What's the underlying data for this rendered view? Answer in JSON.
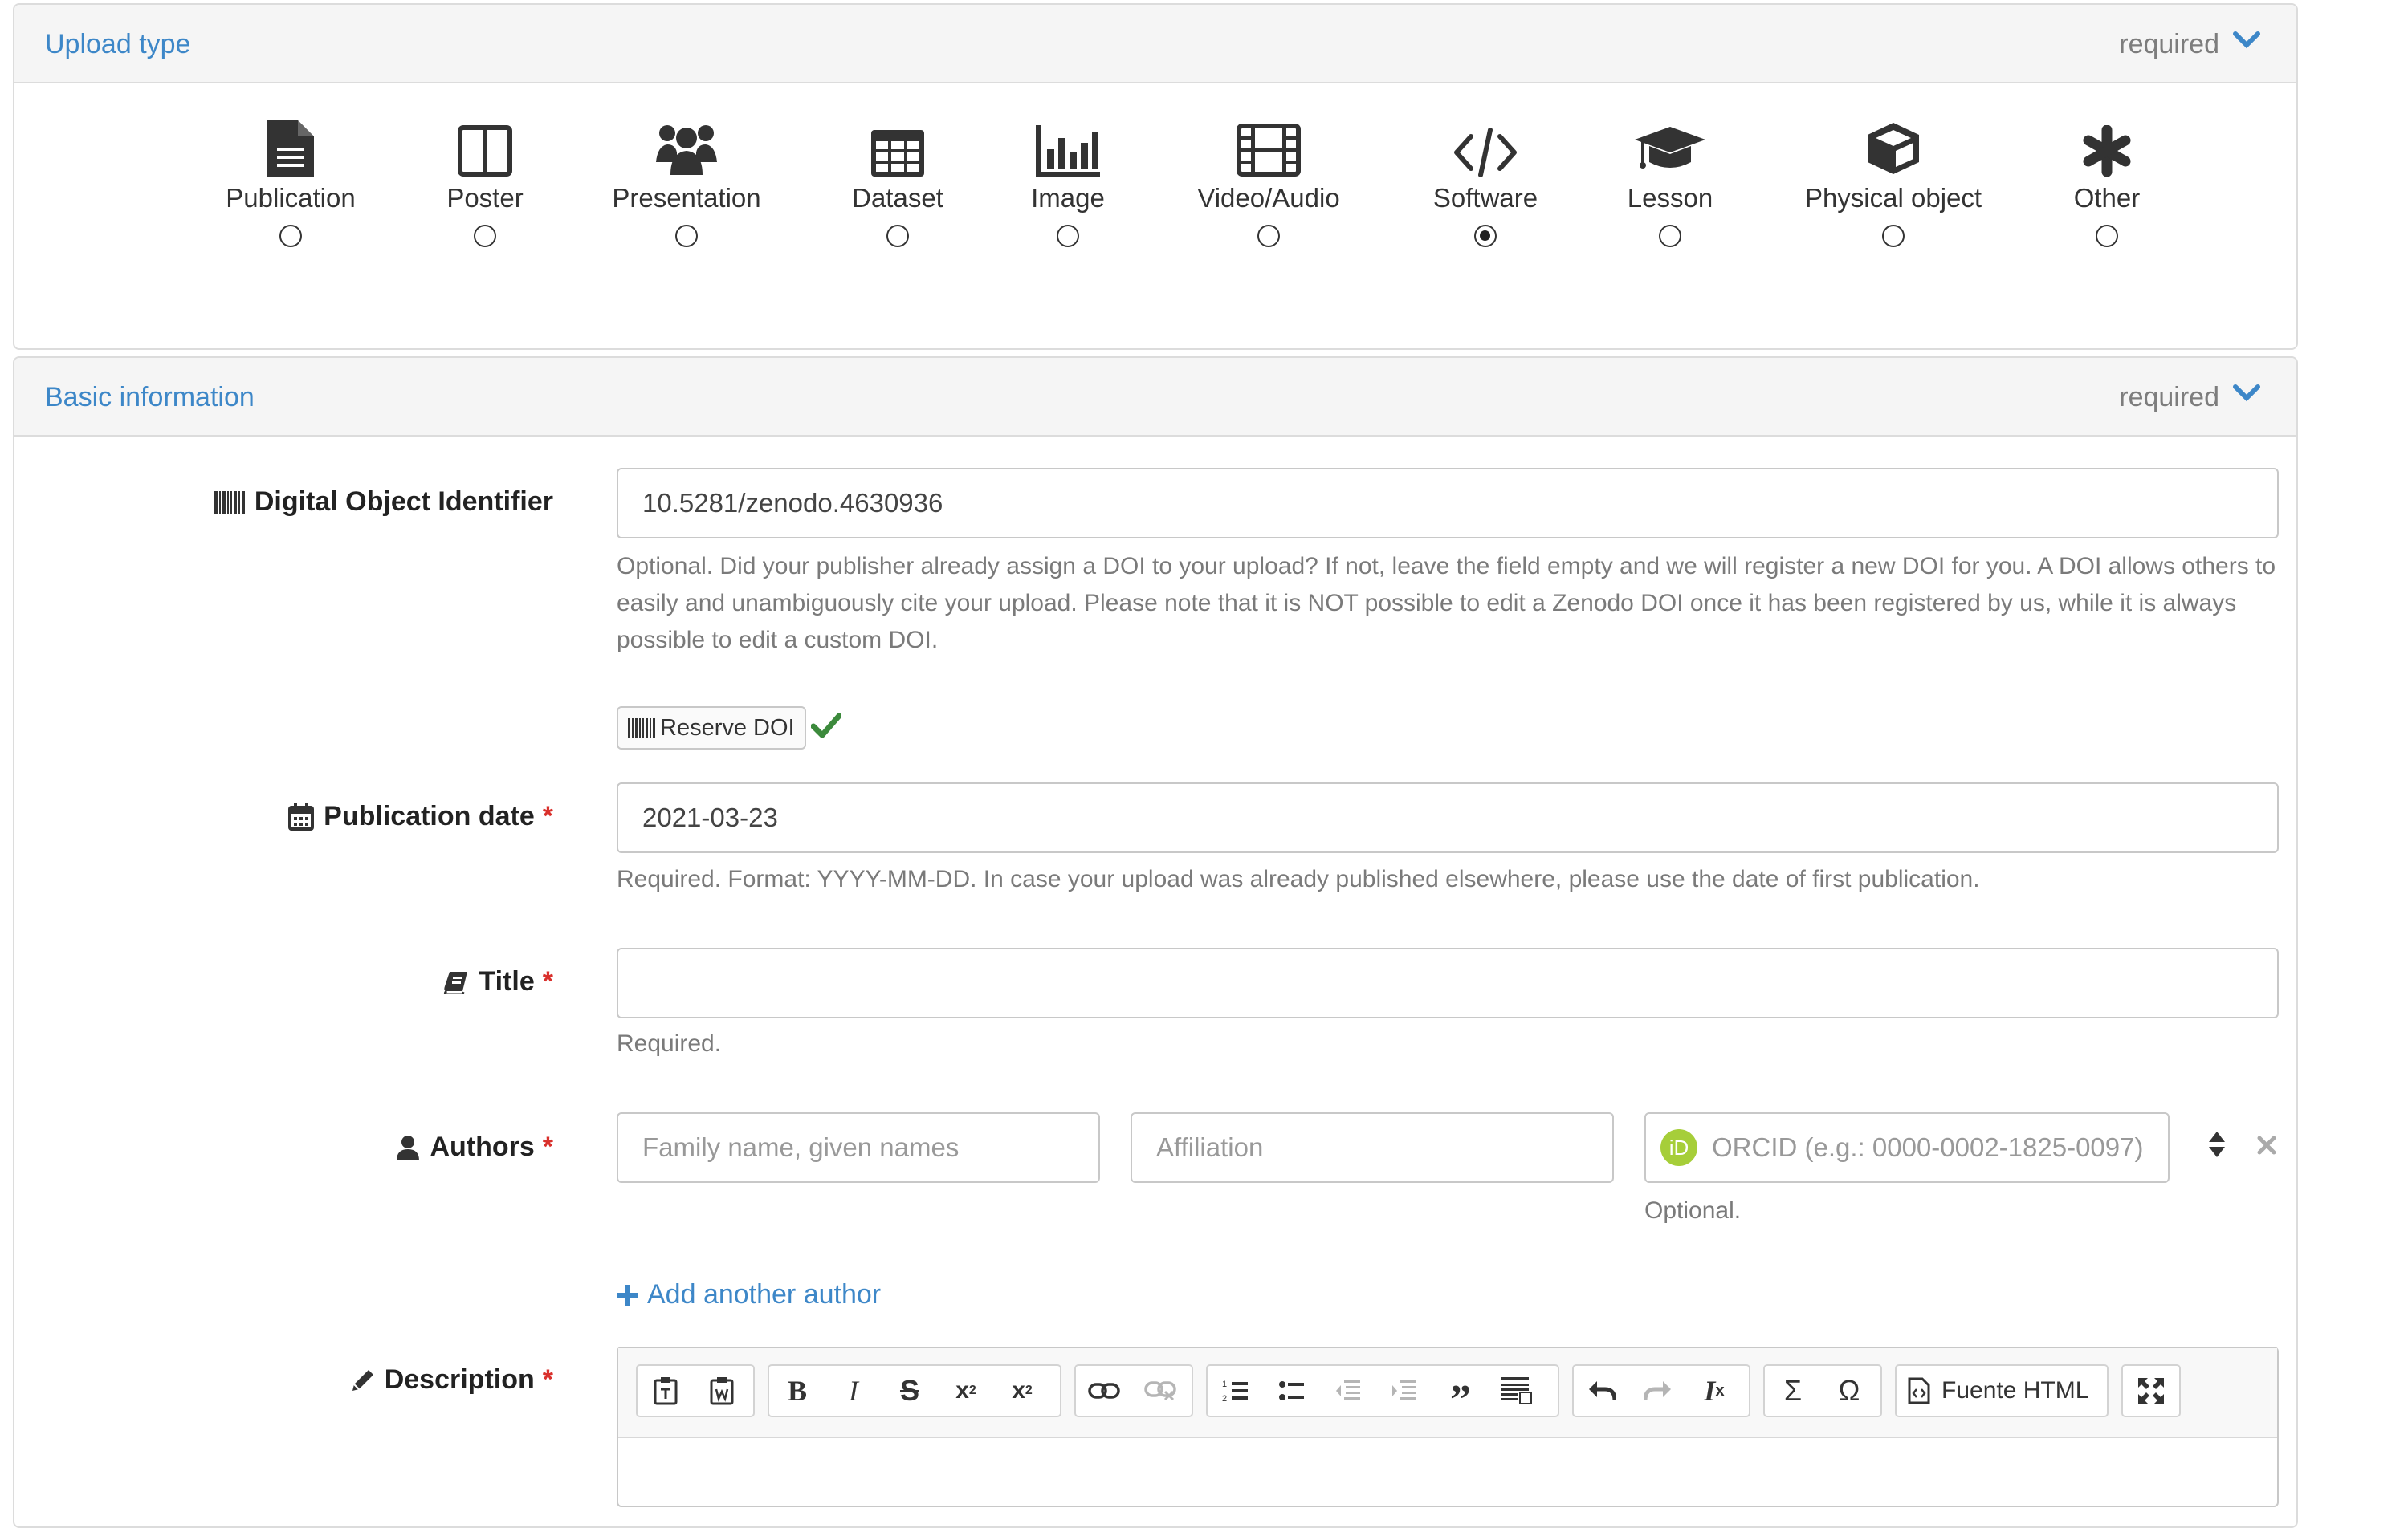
{
  "upload_panel": {
    "title": "Upload type",
    "required": "required",
    "types": [
      {
        "label": "Publication",
        "icon": "file-text-icon",
        "selected": false
      },
      {
        "label": "Poster",
        "icon": "columns-icon",
        "selected": false
      },
      {
        "label": "Presentation",
        "icon": "group-icon",
        "selected": false
      },
      {
        "label": "Dataset",
        "icon": "table-icon",
        "selected": false
      },
      {
        "label": "Image",
        "icon": "bar-chart-icon",
        "selected": false
      },
      {
        "label": "Video/Audio",
        "icon": "film-icon",
        "selected": false
      },
      {
        "label": "Software",
        "icon": "code-icon",
        "selected": true
      },
      {
        "label": "Lesson",
        "icon": "graduation-cap-icon",
        "selected": false
      },
      {
        "label": "Physical object",
        "icon": "cube-icon",
        "selected": false
      },
      {
        "label": "Other",
        "icon": "asterisk-icon",
        "selected": false
      }
    ]
  },
  "basic_panel": {
    "title": "Basic information",
    "required": "required"
  },
  "doi": {
    "label": "Digital Object Identifier",
    "value": "10.5281/zenodo.4630936",
    "help": "Optional. Did your publisher already assign a DOI to your upload? If not, leave the field empty and we will register a new DOI for you. A DOI allows others to easily and unambiguously cite your upload. Please note that it is NOT possible to edit a Zenodo DOI once it has been registered by us, while it is always possible to edit a custom DOI.",
    "reserve_label": "Reserve DOI"
  },
  "pubdate": {
    "label": "Publication date",
    "required_mark": "*",
    "value": "2021-03-23",
    "help": "Required. Format: YYYY-MM-DD. In case your upload was already published elsewhere, please use the date of first publication."
  },
  "title_field": {
    "label": "Title",
    "required_mark": "*",
    "value": "",
    "help": "Required."
  },
  "authors": {
    "label": "Authors",
    "required_mark": "*",
    "name_placeholder": "Family name, given names",
    "affiliation_placeholder": "Affiliation",
    "orcid_badge": "iD",
    "orcid_placeholder": "ORCID (e.g.: 0000-0002-1825-0097)",
    "orcid_help": "Optional.",
    "add_label": "Add another author"
  },
  "description": {
    "label": "Description",
    "required_mark": "*",
    "source_button": "Fuente HTML"
  },
  "colors": {
    "accent": "#3d87c8",
    "required": "#d9302c",
    "check": "#3c8a3c",
    "orcid": "#a6ce39"
  }
}
